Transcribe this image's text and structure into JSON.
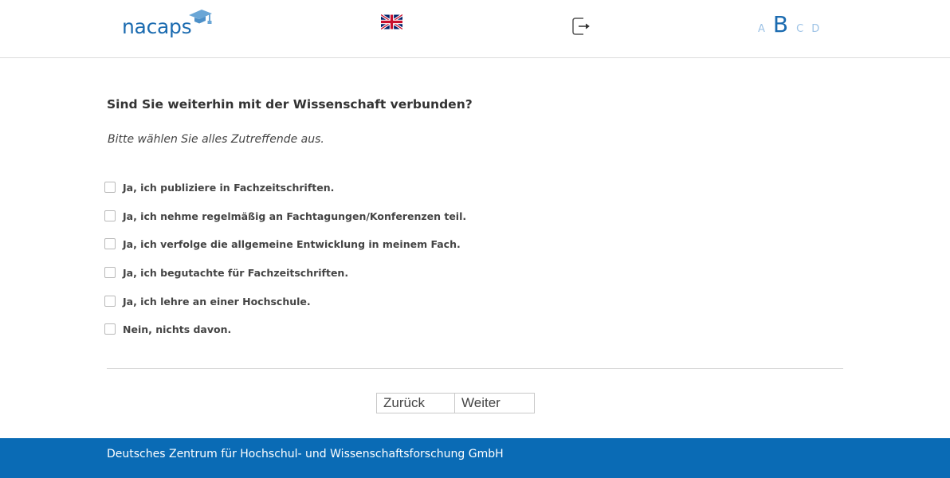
{
  "header": {
    "logo_text": "nacaps",
    "language_flag": "union-jack-flag-icon",
    "logout_icon": "logout-icon",
    "font_sizes": [
      "A",
      "B",
      "C",
      "D"
    ],
    "selected_font_size": "B"
  },
  "survey": {
    "question": "Sind Sie weiterhin mit der Wissenschaft verbunden?",
    "instruction": "Bitte wählen Sie alles Zutreffende aus.",
    "options": [
      {
        "label": "Ja, ich publiziere in Fachzeitschriften.",
        "checked": false
      },
      {
        "label": "Ja, ich nehme regelmäßig an Fachtagungen/Konferenzen teil.",
        "checked": false
      },
      {
        "label": "Ja, ich verfolge die allgemeine Entwicklung in meinem Fach.",
        "checked": false
      },
      {
        "label": "Ja, ich begutachte für Fachzeitschriften.",
        "checked": false
      },
      {
        "label": "Ja, ich lehre an einer Hochschule.",
        "checked": false
      },
      {
        "label": "Nein, nichts davon.",
        "checked": false
      }
    ]
  },
  "navigation": {
    "back_label": "Zurück",
    "next_label": "Weiter"
  },
  "footer": {
    "text": "Deutsches Zentrum für Hochschul- und Wissenschaftsforschung GmbH"
  },
  "colors": {
    "brand_blue": "#1b6bb0",
    "footer_blue": "#0a6bb5",
    "font_size_inactive": "#9ec3e6"
  }
}
